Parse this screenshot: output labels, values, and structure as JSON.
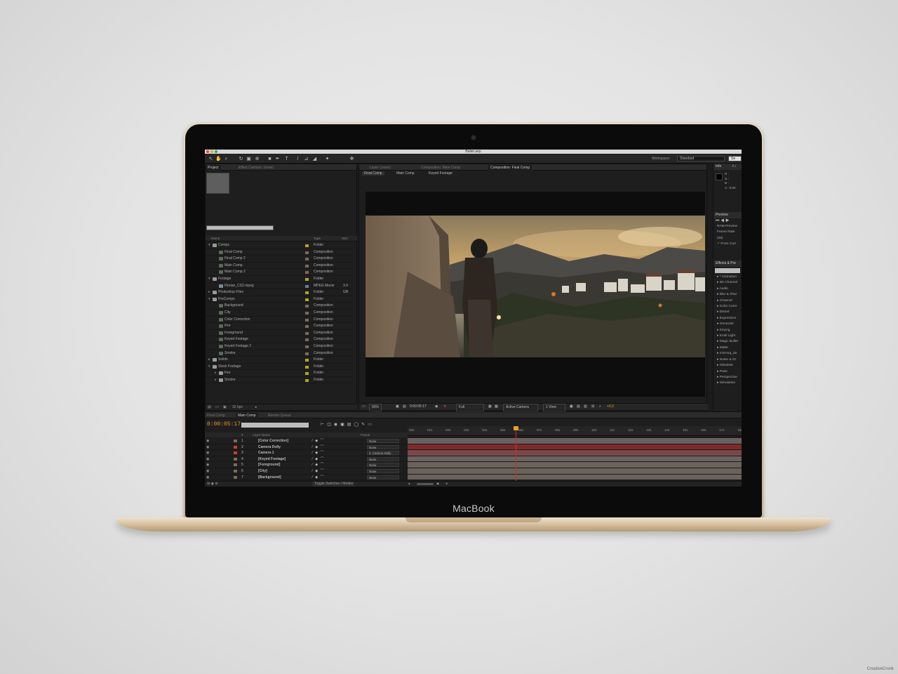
{
  "device": {
    "brand": "MacBook",
    "watermark": "CreativeCrunk"
  },
  "window": {
    "title": "Ballet.aep"
  },
  "toolbar": {
    "workspace_label": "Workspace:",
    "workspace_value": "Standard",
    "search_label": "Se"
  },
  "project_panel": {
    "tabs": [
      "Project",
      "Effect Controls: (none)"
    ],
    "columns": {
      "name": "Name",
      "type": "Type",
      "size": "Size"
    },
    "items": [
      {
        "name": "Comps",
        "type": "Folder",
        "kind": "folder",
        "level": 0,
        "open": true,
        "swatch": "#b7a31e"
      },
      {
        "name": "Final Comp",
        "type": "Composition",
        "kind": "comp",
        "level": 1,
        "swatch": "#7a6b5a"
      },
      {
        "name": "Final Comp 2",
        "type": "Composition",
        "kind": "comp",
        "level": 1,
        "swatch": "#7a6b5a"
      },
      {
        "name": "Main Comp",
        "type": "Composition",
        "kind": "comp",
        "level": 1,
        "swatch": "#7a6b5a"
      },
      {
        "name": "Main Comp 2",
        "type": "Composition",
        "kind": "comp",
        "level": 1,
        "swatch": "#7a6b5a"
      },
      {
        "name": "Footage",
        "type": "Folder",
        "kind": "folder",
        "level": 0,
        "open": true,
        "swatch": "#b7a31e"
      },
      {
        "name": "Florian_CS2.mpeg",
        "type": "MPEG Movie",
        "kind": "file",
        "level": 1,
        "swatch": "#5f7fa8",
        "extra": "3,4 GB"
      },
      {
        "name": "Photoshop Files",
        "type": "Folder",
        "kind": "folder",
        "level": 0,
        "open": false,
        "swatch": "#b7a31e"
      },
      {
        "name": "PreComps",
        "type": "Folder",
        "kind": "folder",
        "level": 0,
        "open": true,
        "swatch": "#b7a31e"
      },
      {
        "name": "Background",
        "type": "Composition",
        "kind": "comp",
        "level": 1,
        "swatch": "#7a6b5a"
      },
      {
        "name": "City",
        "type": "Composition",
        "kind": "comp",
        "level": 1,
        "swatch": "#7a6b5a"
      },
      {
        "name": "Color Correction",
        "type": "Composition",
        "kind": "comp",
        "level": 1,
        "swatch": "#7a6b5a"
      },
      {
        "name": "Fire",
        "type": "Composition",
        "kind": "comp",
        "level": 1,
        "swatch": "#7a6b5a"
      },
      {
        "name": "Foreground",
        "type": "Composition",
        "kind": "comp",
        "level": 1,
        "swatch": "#7a6b5a"
      },
      {
        "name": "Keyed Footage",
        "type": "Composition",
        "kind": "comp",
        "level": 1,
        "swatch": "#7a6b5a"
      },
      {
        "name": "Keyed Footage 2",
        "type": "Composition",
        "kind": "comp",
        "level": 1,
        "swatch": "#7a6b5a"
      },
      {
        "name": "Smoke",
        "type": "Composition",
        "kind": "comp",
        "level": 1,
        "swatch": "#7a6b5a"
      },
      {
        "name": "Solids",
        "type": "Folder",
        "kind": "folder",
        "level": 0,
        "open": false,
        "swatch": "#b7a31e"
      },
      {
        "name": "Stock Footage",
        "type": "Folder",
        "kind": "folder",
        "level": 0,
        "open": true,
        "swatch": "#b7a31e"
      },
      {
        "name": "Fire",
        "type": "Folder",
        "kind": "folder",
        "level": 1,
        "open": false,
        "swatch": "#b7a31e"
      },
      {
        "name": "Smoke",
        "type": "Folder",
        "kind": "folder",
        "level": 1,
        "open": false,
        "swatch": "#b7a31e"
      }
    ],
    "bpc": "32 bpc"
  },
  "composition_panel": {
    "tabs": [
      "Layer: (none)",
      "Composition: Main Comp",
      "Composition: Final Comp"
    ],
    "flow": [
      "Final Comp",
      "Main Comp",
      "Keyed Footage"
    ],
    "controls": {
      "zoom": "50%",
      "timecode": "0:00:05:17",
      "resolution": "Full",
      "camera": "Active Camera",
      "views": "1 View",
      "exposure": "+0,0"
    }
  },
  "info_panel": {
    "tab": "Info",
    "tab2": "Au",
    "readout": [
      "R :",
      "G :",
      "B :",
      "A : 0,00"
    ]
  },
  "preview_panel": {
    "title": "Preview",
    "ram": "RAM Preview",
    "frame_rate_label": "Frame Rate",
    "frame_rate": "(25)",
    "from_current": "From Curr"
  },
  "effects_panel": {
    "title": "Effects & Pre",
    "items": [
      "* Animation",
      "3D Channel",
      "Audio",
      "Blur & Shar",
      "Channel",
      "Color Corre",
      "Distort",
      "Expression",
      "Generate",
      "Keying",
      "Knoll Light",
      "Magic Bullet",
      "Matte",
      "mirrmrg_de",
      "Noise & Gr",
      "Obsolete",
      "Paint",
      "Perspective",
      "Simulation"
    ]
  },
  "timeline": {
    "tabs": [
      "Final Comp",
      "Main Comp",
      "Render Queue"
    ],
    "timecode": "0:00:05:17",
    "columns": {
      "num": "#",
      "name": "Layer Name",
      "parent": "Parent"
    },
    "ticks": [
      "00s",
      "01s",
      "02s",
      "03s",
      "04s",
      "05s",
      "06s",
      "07s",
      "08s",
      "09s",
      "10s",
      "11s",
      "12s",
      "13s",
      "14s",
      "15s",
      "16s",
      "17s",
      "18s"
    ],
    "current_time_seconds": 5.68,
    "layers": [
      {
        "num": "1",
        "name": "[Color Correction]",
        "label": "#7a6b5a",
        "parent": "None",
        "bar": "#6b6060"
      },
      {
        "num": "2",
        "name": "Camera Dolly",
        "label": "#c6422c",
        "parent": "None",
        "bar": "#7f2b2b"
      },
      {
        "num": "3",
        "name": "Camera 1",
        "label": "#c6422c",
        "parent": "2. Camera Dolly",
        "bar": "#7a4848"
      },
      {
        "num": "4",
        "name": "[Keyed Footage]",
        "label": "#7a6b5a",
        "parent": "None",
        "bar": "#6b6360"
      },
      {
        "num": "5",
        "name": "[Foreground]",
        "label": "#7a6b5a",
        "parent": "None",
        "bar": "#6a635b"
      },
      {
        "num": "6",
        "name": "[City]",
        "label": "#7a6b5a",
        "parent": "None",
        "bar": "#6a635b"
      },
      {
        "num": "7",
        "name": "[Background]",
        "label": "#7a6b5a",
        "parent": "None",
        "bar": "#6a635b"
      }
    ],
    "footer": "Toggle Switches / Modes"
  }
}
